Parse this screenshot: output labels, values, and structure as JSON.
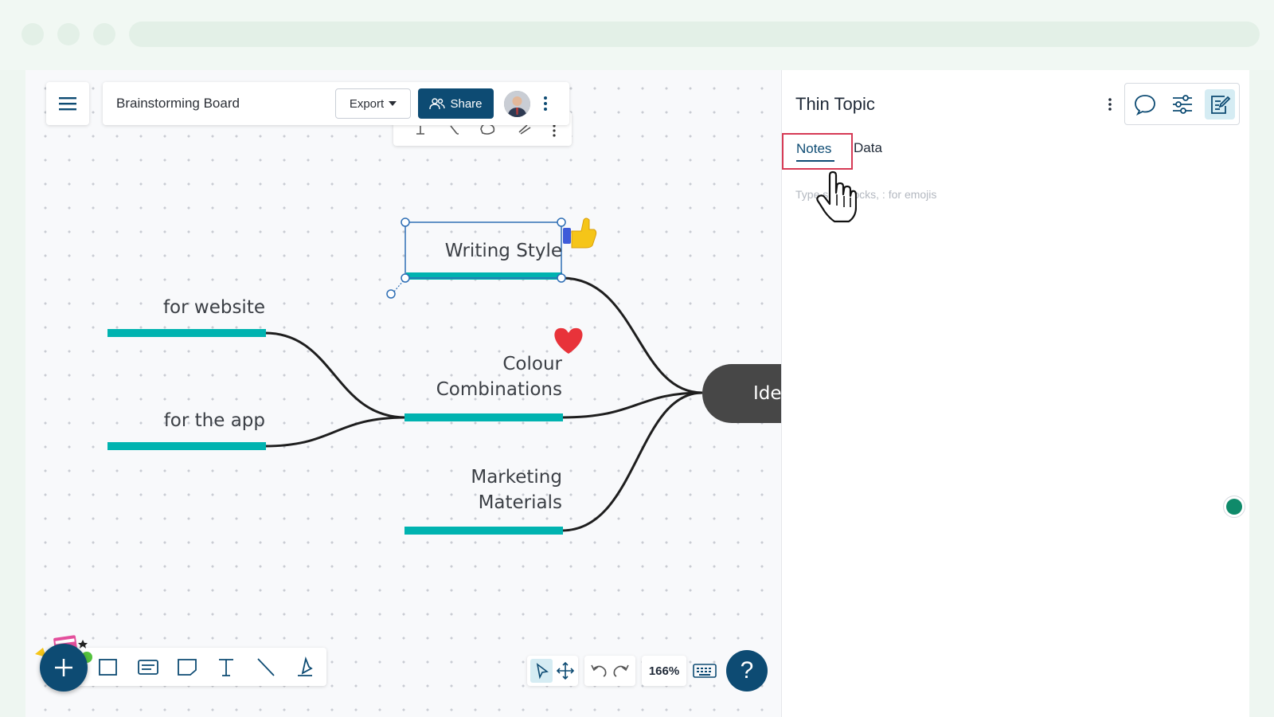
{
  "toolbar": {
    "board_title": "Brainstorming Board",
    "export_label": "Export",
    "share_label": "Share"
  },
  "mindmap": {
    "central_topic": "Ide",
    "topics": [
      {
        "label": "Writing Style",
        "emoji": "thumbs-up"
      },
      {
        "label_lines": [
          "Colour",
          "Combinations"
        ],
        "emoji": "heart"
      },
      {
        "label_lines": [
          "Marketing",
          "Materials"
        ]
      }
    ],
    "subtopics": [
      "for website",
      "for the app"
    ],
    "branch_color": "#00b3b0"
  },
  "panel": {
    "title": "Thin Topic",
    "tabs": [
      {
        "label": "Notes",
        "active": true
      },
      {
        "label": "Data",
        "active": false
      }
    ],
    "notes_placeholder": "Type / to insert blocks, : for emojis",
    "notes_placeholder_visible": "Type       sert blocks, : for emojis",
    "icons": [
      "comment-icon",
      "settings-sliders-icon",
      "notes-edit-icon"
    ]
  },
  "bottom": {
    "zoom": "166%",
    "help": "?"
  },
  "colors": {
    "primary": "#0d4b73",
    "accent_teal": "#00b3b0",
    "highlight_red": "#d63a55"
  }
}
